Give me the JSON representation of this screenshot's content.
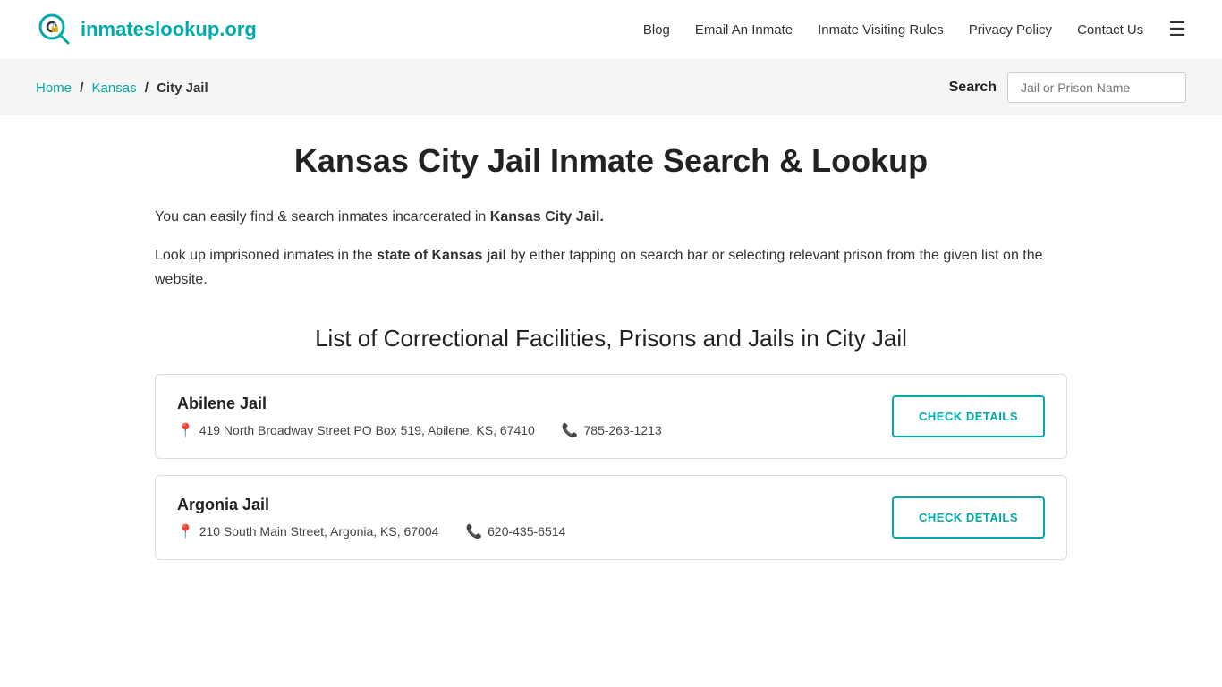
{
  "header": {
    "logo_text_plain": "inmates",
    "logo_text_accent": "lookup.org",
    "nav": {
      "blog": "Blog",
      "email_inmate": "Email An Inmate",
      "visiting_rules": "Inmate Visiting Rules",
      "privacy_policy": "Privacy Policy",
      "contact_us": "Contact Us"
    }
  },
  "breadcrumb": {
    "home": "Home",
    "state": "Kansas",
    "category": "City Jail",
    "search_label": "Search",
    "search_placeholder": "Jail or Prison Name"
  },
  "main": {
    "page_title": "Kansas City Jail Inmate Search & Lookup",
    "intro_p1_prefix": "You can easily find & search inmates incarcerated in ",
    "intro_p1_bold": "Kansas City Jail.",
    "intro_p2_prefix": "Look up imprisoned inmates in the ",
    "intro_p2_bold": "state of Kansas jail",
    "intro_p2_suffix": " by either tapping on search bar or selecting relevant prison from the given list on the website.",
    "section_title": "List of Correctional Facilities, Prisons and Jails in City Jail",
    "facilities": [
      {
        "name": "Abilene Jail",
        "address": "419 North Broadway Street PO Box 519, Abilene, KS, 67410",
        "phone": "785-263-1213",
        "btn_label": "CHECK DETAILS"
      },
      {
        "name": "Argonia Jail",
        "address": "210 South Main Street, Argonia, KS, 67004",
        "phone": "620-435-6514",
        "btn_label": "CHECK DETAILS"
      }
    ]
  }
}
